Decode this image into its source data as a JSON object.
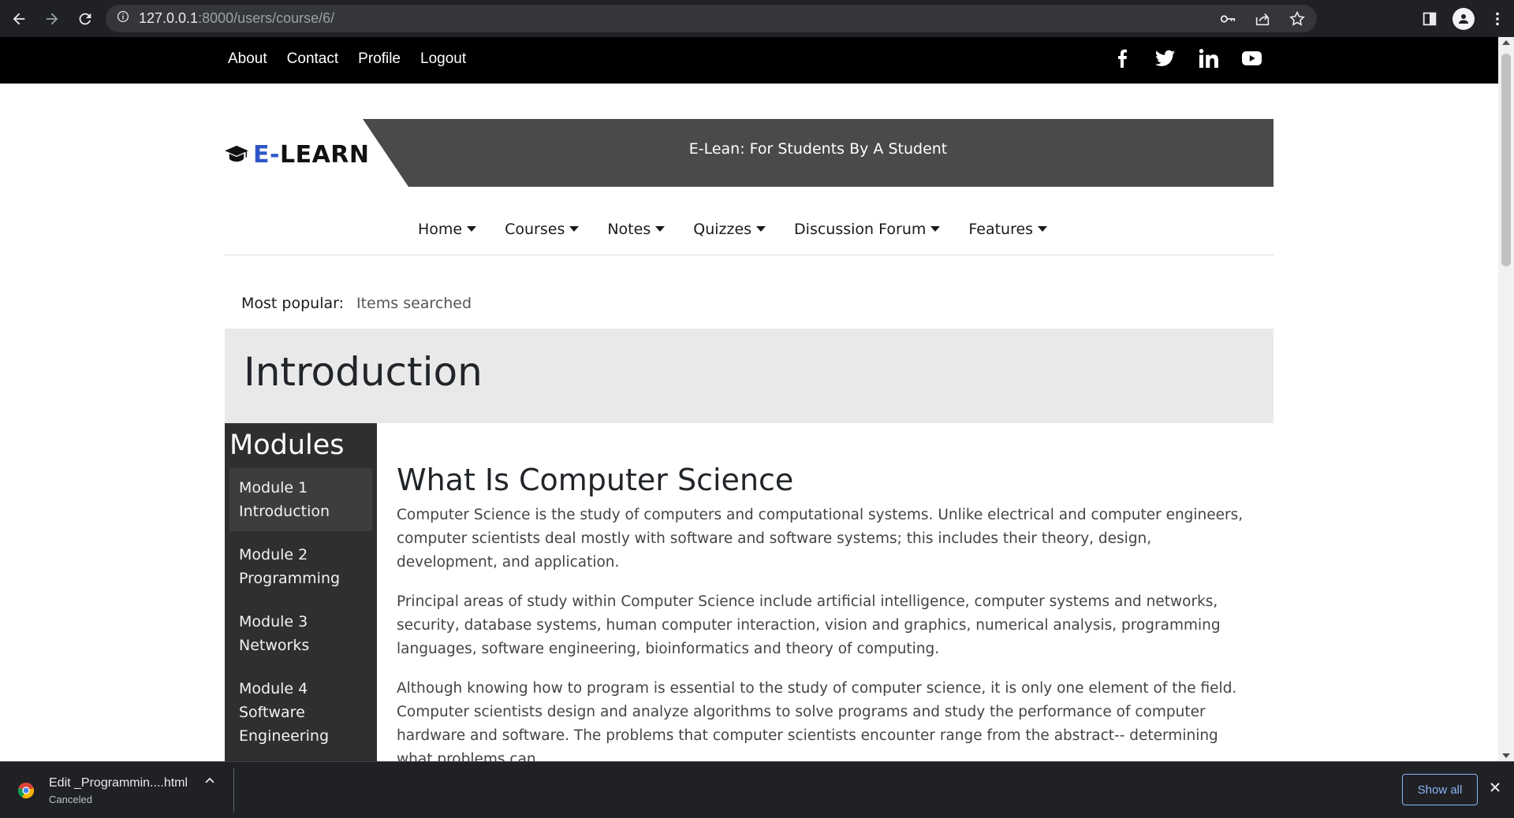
{
  "browser": {
    "url_host": "127.0.0.1",
    "url_path": ":8000/users/course/6/"
  },
  "topbar": {
    "links": [
      "About",
      "Contact",
      "Profile",
      "Logout"
    ],
    "social_icons": [
      "facebook-icon",
      "twitter-icon",
      "linkedin-icon",
      "youtube-icon"
    ]
  },
  "brand": {
    "logo_accent": "E-",
    "logo_rest": "LEARN",
    "tagline": "E-Lean: For Students By A Student",
    "accent_color": "#2f55c8"
  },
  "mainnav": {
    "items": [
      "Home",
      "Courses",
      "Notes",
      "Quizzes",
      "Discussion Forum",
      "Features"
    ]
  },
  "popular": {
    "label": "Most popular:",
    "value": "Items searched"
  },
  "page": {
    "title": "Introduction"
  },
  "sidebar": {
    "heading": "Modules",
    "modules": [
      {
        "line1": "Module 1",
        "line2": "Introduction",
        "line3": ""
      },
      {
        "line1": "Module 2",
        "line2": "Programming",
        "line3": ""
      },
      {
        "line1": "Module 3",
        "line2": "Networks",
        "line3": ""
      },
      {
        "line1": "Module 4",
        "line2": "Software",
        "line3": "Engineering"
      }
    ]
  },
  "article": {
    "heading": "What Is Computer Science",
    "paragraphs": [
      "Computer Science is the study of computers and computational systems. Unlike electrical and computer engineers, computer scientists deal mostly with software and software systems; this includes their theory, design, development, and application.",
      "Principal areas of study within Computer Science include artificial intelligence, computer systems and networks, security, database systems, human computer interaction, vision and graphics, numerical analysis, programming languages, software engineering, bioinformatics and theory of computing.",
      "Although knowing how to program is essential to the study of computer science, it is only one element of the field. Computer scientists design and analyze algorithms to solve programs and study the performance of computer hardware and software. The problems that computer scientists encounter range from the abstract-- determining what problems can"
    ]
  },
  "downloads": {
    "filename": "Edit _Programmin....html",
    "status": "Canceled",
    "show_all": "Show all"
  }
}
